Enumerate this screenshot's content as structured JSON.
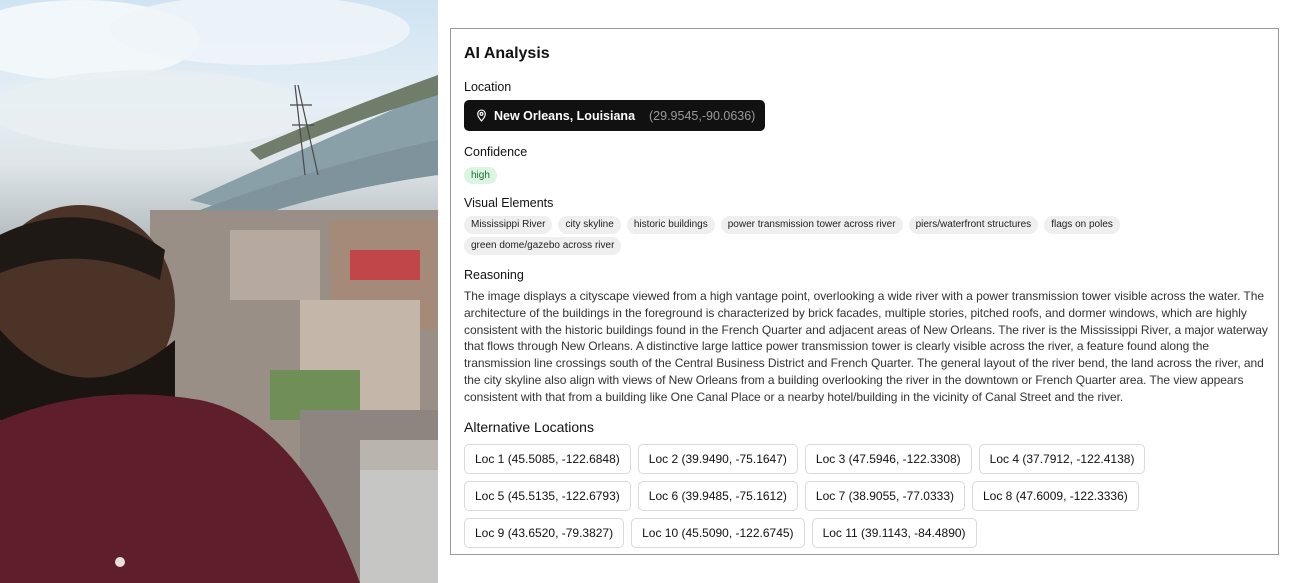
{
  "photo": {
    "alt": "Selfie overlooking a city and river"
  },
  "panel": {
    "title": "AI Analysis",
    "location": {
      "label": "Location",
      "name": "New Orleans, Louisiana",
      "coords": "(29.9545,-90.0636)",
      "icon": "map-pin-icon"
    },
    "confidence": {
      "label": "Confidence",
      "value": "high",
      "color": "#dcf5e2"
    },
    "visual_elements": {
      "label": "Visual Elements",
      "items": [
        "Mississippi River",
        "city skyline",
        "historic buildings",
        "power transmission tower across river",
        "piers/waterfront structures",
        "flags on poles",
        "green dome/gazebo across river"
      ]
    },
    "reasoning": {
      "label": "Reasoning",
      "text": "The image displays a cityscape viewed from a high vantage point, overlooking a wide river with a power transmission tower visible across the water. The architecture of the buildings in the foreground is characterized by brick facades, multiple stories, pitched roofs, and dormer windows, which are highly consistent with the historic buildings found in the French Quarter and adjacent areas of New Orleans. The river is the Mississippi River, a major waterway that flows through New Orleans. A distinctive large lattice power transmission tower is clearly visible across the river, a feature found along the transmission line crossings south of the Central Business District and French Quarter. The general layout of the river bend, the land across the river, and the city skyline also align with views of New Orleans from a building overlooking the river in the downtown or French Quarter area. The view appears consistent with that from a building like One Canal Place or a nearby hotel/building in the vicinity of Canal Street and the river."
    },
    "alternatives": {
      "label": "Alternative Locations",
      "items": [
        "Loc 1 (45.5085, -122.6848)",
        "Loc 2 (39.9490, -75.1647)",
        "Loc 3 (47.5946, -122.3308)",
        "Loc 4 (37.7912, -122.4138)",
        "Loc 5 (45.5135, -122.6793)",
        "Loc 6 (39.9485, -75.1612)",
        "Loc 7 (38.9055, -77.0333)",
        "Loc 8 (47.6009, -122.3336)",
        "Loc 9 (43.6520, -79.3827)",
        "Loc 10 (45.5090, -122.6745)",
        "Loc 11 (39.1143, -84.4890)"
      ]
    }
  }
}
